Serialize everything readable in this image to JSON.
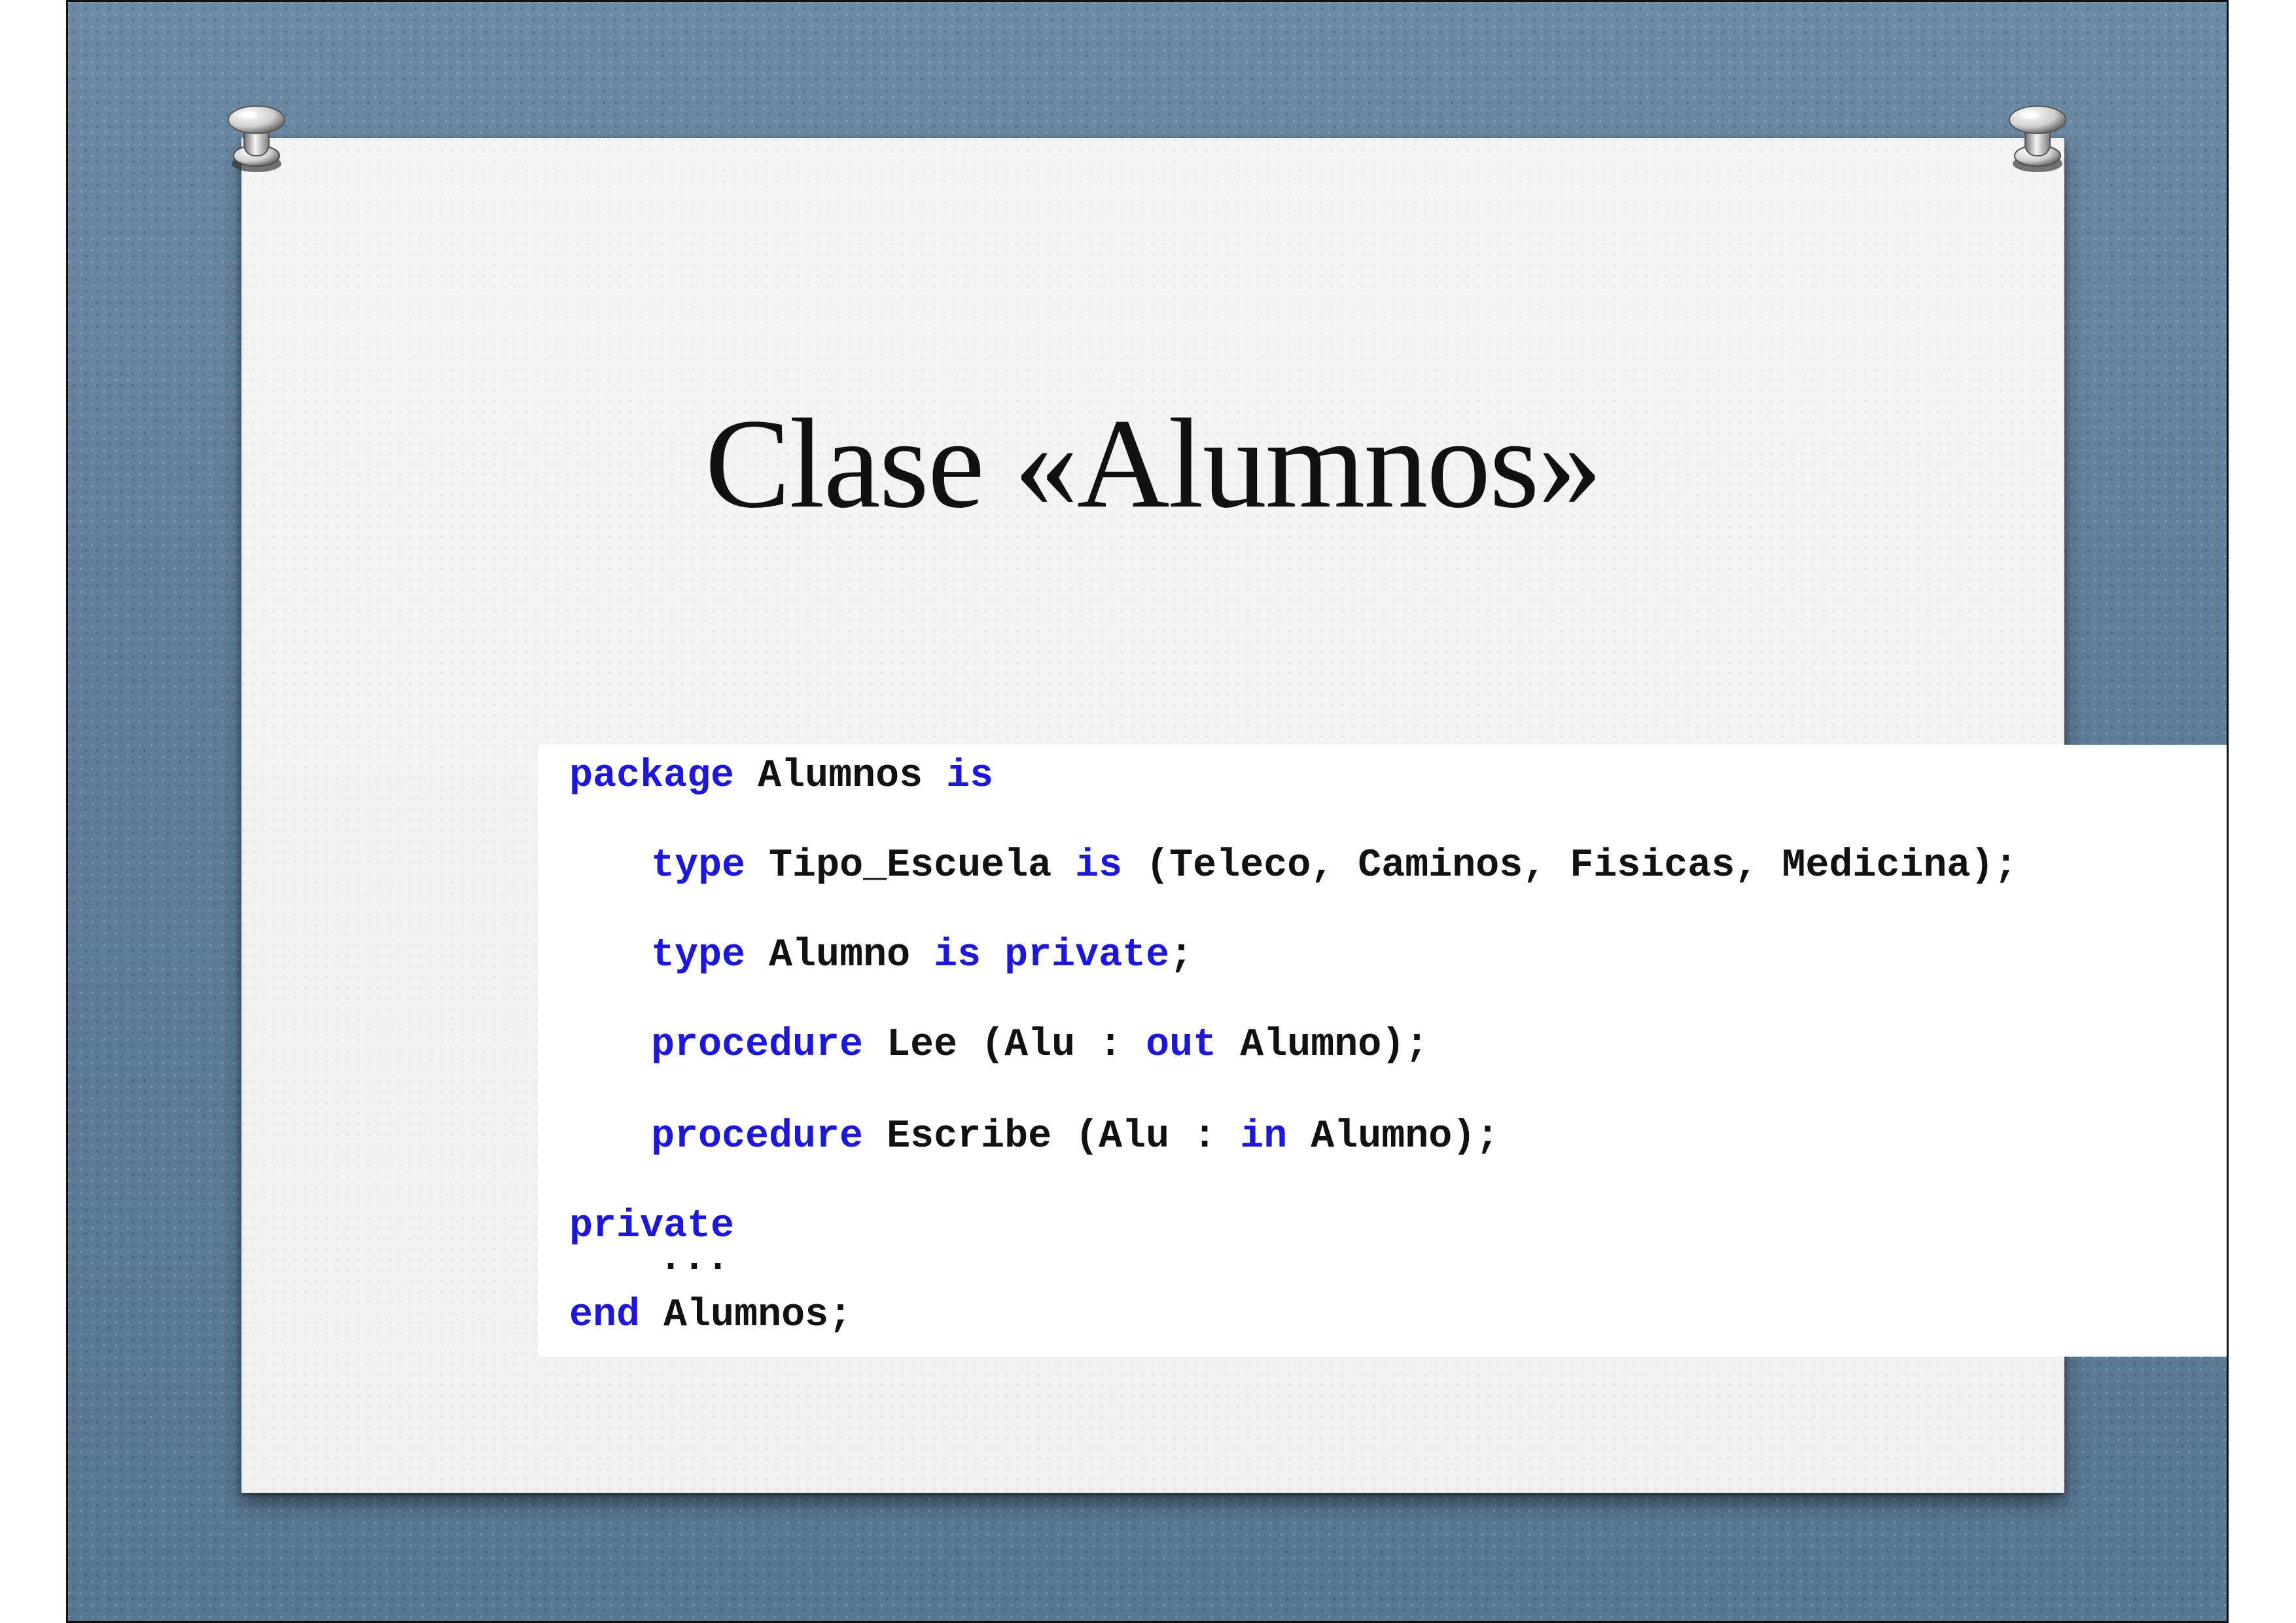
{
  "slide": {
    "title": "Clase «Alumnos»",
    "background_color": "#5f7d99",
    "paper_color": "#f2f2f2",
    "keyword_color": "#1d17d8",
    "text_color": "#111111",
    "icons": [
      "push-pin-icon",
      "push-pin-icon"
    ]
  },
  "code": {
    "line1": {
      "kw1": "package",
      "id1": "Alumnos",
      "kw2": "is"
    },
    "line2": {
      "kw1": "type",
      "id1": "Tipo_Escuela",
      "kw2": "is",
      "rest": "(Teleco, Caminos, Fisicas, Medicina);"
    },
    "line3": {
      "kw1": "type",
      "id1": "Alumno",
      "kw2": "is",
      "kw3": "private",
      "rest": ";"
    },
    "line4": {
      "kw1": "procedure",
      "id1": "Lee (Alu :",
      "kw2": "out",
      "rest": "Alumno);"
    },
    "line5": {
      "kw1": "procedure",
      "id1": "Escribe (Alu :",
      "kw2": "in",
      "rest": "Alumno);"
    },
    "line6": {
      "kw1": "private"
    },
    "line7": {
      "text": "..."
    },
    "line8": {
      "kw1": "end",
      "rest": "Alumnos;"
    }
  }
}
